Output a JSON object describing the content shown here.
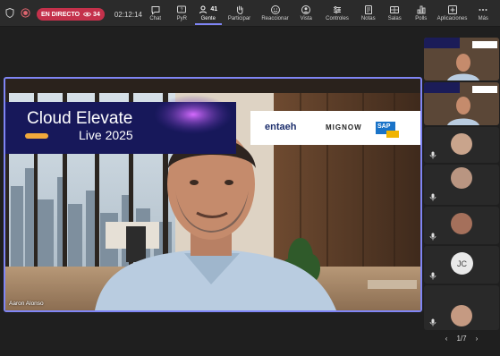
{
  "meeting": {
    "live_label": "EN DIRECTO",
    "viewers": "34",
    "elapsed": "02:12:14"
  },
  "toolbar": {
    "items": [
      {
        "label": "Chat",
        "icon": "chat-icon"
      },
      {
        "label": "PyR",
        "icon": "qa-icon"
      },
      {
        "label": "Gente",
        "icon": "people-icon",
        "count": "41",
        "active": true
      },
      {
        "label": "Participar",
        "icon": "raise-hand-icon"
      },
      {
        "label": "Reaccionar",
        "icon": "react-icon"
      },
      {
        "label": "Vista",
        "icon": "view-icon"
      },
      {
        "label": "Controles",
        "icon": "controls-icon"
      },
      {
        "label": "Notas",
        "icon": "notes-icon"
      },
      {
        "label": "Salas",
        "icon": "rooms-icon"
      },
      {
        "label": "Polls",
        "icon": "polls-icon"
      },
      {
        "label": "Aplicaciones",
        "icon": "apps-icon"
      },
      {
        "label": "Más",
        "icon": "more-icon"
      }
    ]
  },
  "stage": {
    "speaker_name": "Aaron Alonso",
    "banner_title": "Cloud Elevate",
    "banner_subtitle": "Live 2025",
    "sponsors": [
      "entaeh",
      "MIGNOW",
      "SAP"
    ]
  },
  "participants": {
    "initials": "JC",
    "page": "1/7"
  },
  "colors": {
    "live_red": "#c4314b",
    "accent": "#7f85f5",
    "background": "#1f1f1f",
    "toolbar_bg": "#2b2b2b"
  }
}
